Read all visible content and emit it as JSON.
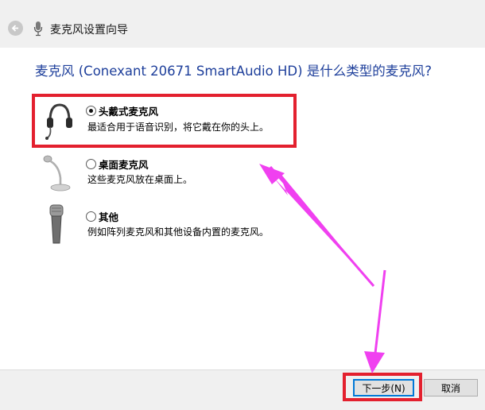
{
  "window": {
    "title": "麦克风设置向导"
  },
  "heading": "麦克风 (Conexant 20671 SmartAudio HD) 是什么类型的麦克风?",
  "options": [
    {
      "label": "头戴式麦克风",
      "description": "最适合用于语音识别，将它戴在你的头上。",
      "icon": "headset-icon",
      "selected": true
    },
    {
      "label": "桌面麦克风",
      "description": "这些麦克风放在桌面上。",
      "icon": "desk-microphone-icon",
      "selected": false
    },
    {
      "label": "其他",
      "description": "例如阵列麦克风和其他设备内置的麦克风。",
      "icon": "handheld-microphone-icon",
      "selected": false
    }
  ],
  "buttons": {
    "next": "下一步(N)",
    "cancel": "取消"
  },
  "colors": {
    "annotation_red": "#e3202e",
    "annotation_arrow": "#f040f0",
    "heading_blue": "#1e3f9b"
  }
}
